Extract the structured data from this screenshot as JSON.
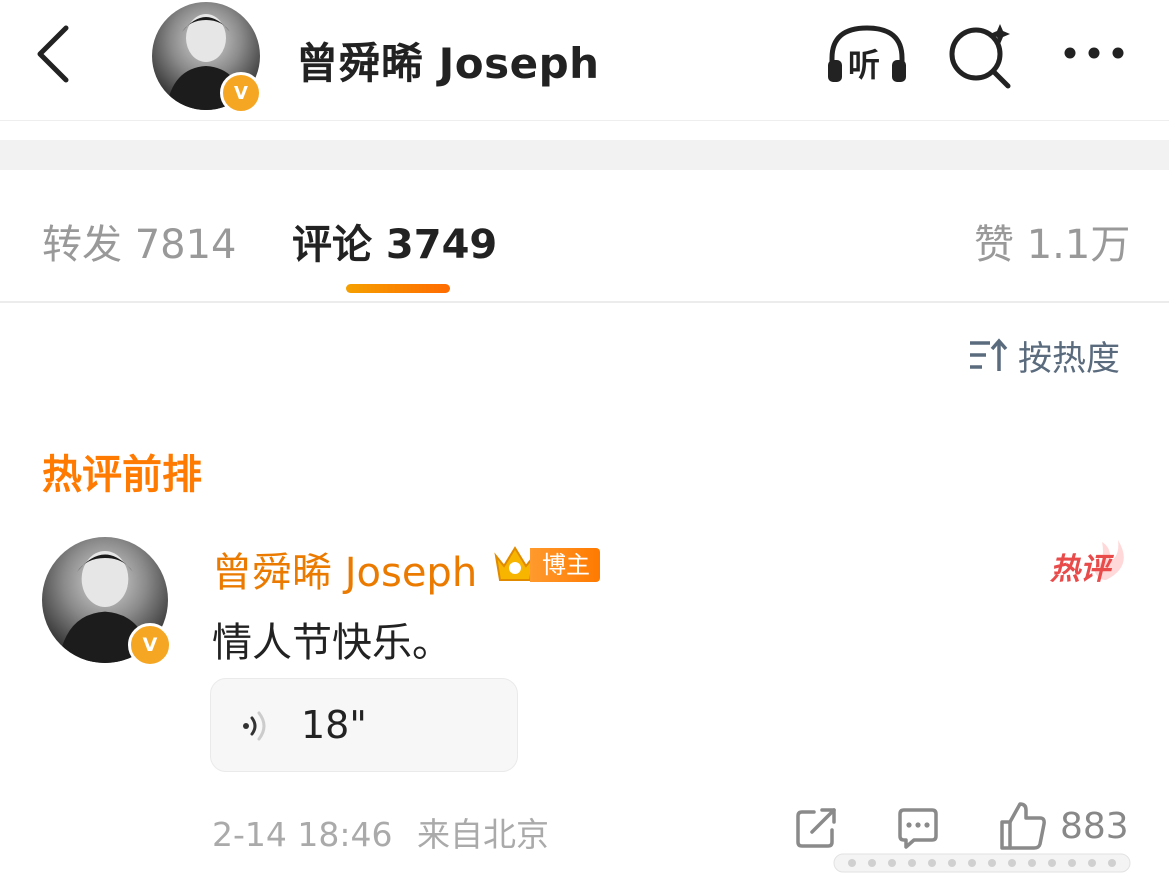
{
  "header": {
    "title": "曾舜晞 Joseph",
    "listen_label": "听",
    "verified_badge": "V"
  },
  "tabs": [
    {
      "label": "转发 7814"
    },
    {
      "label": "评论 3749"
    },
    {
      "label": "赞 1.1万"
    }
  ],
  "sort": {
    "label": "按热度"
  },
  "section": {
    "title": "热评前排"
  },
  "comment": {
    "author": "曾舜晞 Joseph",
    "badge_label": "博主",
    "hot_label": "热评",
    "verified_badge": "V",
    "text": "情人节快乐。",
    "voice_duration": "18\"",
    "time": "2-14 18:46",
    "location": "来自北京",
    "like_count": "883"
  },
  "colors": {
    "accent": "#ff7a00",
    "author": "#eb7a00",
    "sort": "#5b6b7e",
    "verified": "#f5a623"
  }
}
